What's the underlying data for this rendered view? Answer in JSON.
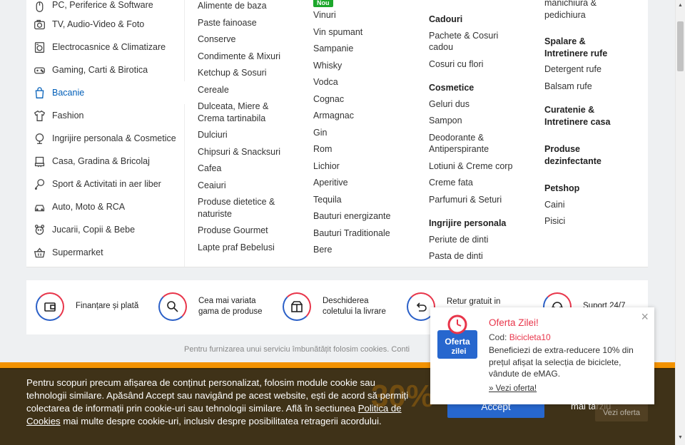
{
  "sidebar": {
    "items": [
      {
        "label": "PC, Periferice & Software",
        "icon": "mouse-icon"
      },
      {
        "label": "TV, Audio-Video & Foto",
        "icon": "camera-icon"
      },
      {
        "label": "Electrocasnice & Climatizare",
        "icon": "washing-machine-icon"
      },
      {
        "label": "Gaming, Carti & Birotica",
        "icon": "gamepad-icon"
      },
      {
        "label": "Bacanie",
        "icon": "shopping-bag-icon",
        "active": true
      },
      {
        "label": "Fashion",
        "icon": "shirt-icon"
      },
      {
        "label": "Ingrijire personala & Cosmetice",
        "icon": "cosmetics-icon"
      },
      {
        "label": "Casa, Gradina & Bricolaj",
        "icon": "house-icon"
      },
      {
        "label": "Sport & Activitati in aer liber",
        "icon": "sport-icon"
      },
      {
        "label": "Auto, Moto & RCA",
        "icon": "car-icon"
      },
      {
        "label": "Jucarii, Copii & Bebe",
        "icon": "teddy-bear-icon"
      },
      {
        "label": "Supermarket",
        "icon": "basket-icon"
      }
    ]
  },
  "columns": {
    "col1": [
      "Alimente de baza",
      "Paste fainoase",
      "Conserve",
      "Condimente & Mixuri",
      "Ketchup & Sosuri",
      "Cereale",
      "Dulceata, Miere & Crema tartinabila",
      "Dulciuri",
      "Chipsuri & Snacksuri",
      "Cafea",
      "Ceaiuri",
      "Produse dietetice & naturiste",
      "Produse Gourmet",
      "Lapte praf Bebelusi"
    ],
    "col2_badge": "Nou",
    "col2": [
      "Vinuri",
      "Vin spumant",
      "Sampanie",
      "Whisky",
      "Vodca",
      "Cognac",
      "Armagnac",
      "Gin",
      "Rom",
      "Lichior",
      "Aperitive",
      "Tequila",
      "Bauturi energizante",
      "Bauturi Traditionale",
      "Bere"
    ],
    "col3": {
      "cadouri_heading": "Cadouri",
      "cadouri": [
        "Pachete & Cosuri cadou",
        "Cosuri cu flori"
      ],
      "cosmetice_heading": "Cosmetice",
      "cosmetice": [
        "Geluri dus",
        "Sampon",
        "Deodorante & Antiperspirante",
        "Lotiuni & Creme corp",
        "Creme fata",
        "Parfumuri & Seturi"
      ],
      "ingrijire_heading": "Ingrijire personala",
      "ingrijire": [
        "Periute de dinti",
        "Pasta de dinti"
      ]
    },
    "col4": {
      "top_link": "manichiura & pedichiura",
      "spalare_heading": "Spalare & Intretinere rufe",
      "spalare": [
        "Detergent rufe",
        "Balsam rufe"
      ],
      "curatenie_heading": "Curatenie & Intretinere casa",
      "dezinf_heading": "Produse dezinfectante",
      "petshop_heading": "Petshop",
      "petshop": [
        "Caini",
        "Pisici"
      ]
    }
  },
  "benefits": [
    {
      "label": "Finanțare și plată",
      "icon": "wallet-icon"
    },
    {
      "label": "Cea mai variata gama de produse",
      "icon": "magnifier-icon"
    },
    {
      "label": "Deschiderea coletului la livrare",
      "icon": "open-box-icon"
    },
    {
      "label": "Retur gratuit in",
      "icon": "return-arrow-icon"
    },
    {
      "label": "Suport 24/7",
      "icon": "headset-icon"
    }
  ],
  "cookies_note": "Pentru furnizarea unui serviciu îmbunătățit folosim cookies. Conti",
  "cookie_banner": {
    "text_before_link": "Pentru scopuri precum afișarea de conținut personalizat, folosim module cookie sau tehnologii similare. Apăsând Accept sau navigând pe acest website, ești de acord să permiți colectarea de informații prin cookie-uri sau tehnologii similare. Află în sectiunea",
    "policy_link": "Politica de Cookies",
    "text_after_link": " mai multe despre cookie-uri, inclusiv despre posibilitatea retragerii acordului.",
    "accept": "Accept",
    "later": "mai tarziu",
    "ghost_promo": "30% 40"
  },
  "vezi_oferta_right": "Vezi oferta",
  "oferta": {
    "logo_line1": "Oferta",
    "logo_line2": "zilei",
    "title": "Oferta Zilei!",
    "code_label": "Cod: ",
    "code_value": "Bicicleta10",
    "description": "Beneficiezi de extra-reducere 10% din prețul afișat la selecția de biciclete, vândute de eMAG.",
    "link": "» Vezi oferta!",
    "close": "×"
  },
  "colors": {
    "accent_blue": "#005eb8",
    "accept_blue": "#2767ce",
    "emag_red": "#e8354a",
    "badge_green": "#1ca72b",
    "promo_orange": "#f39200"
  }
}
